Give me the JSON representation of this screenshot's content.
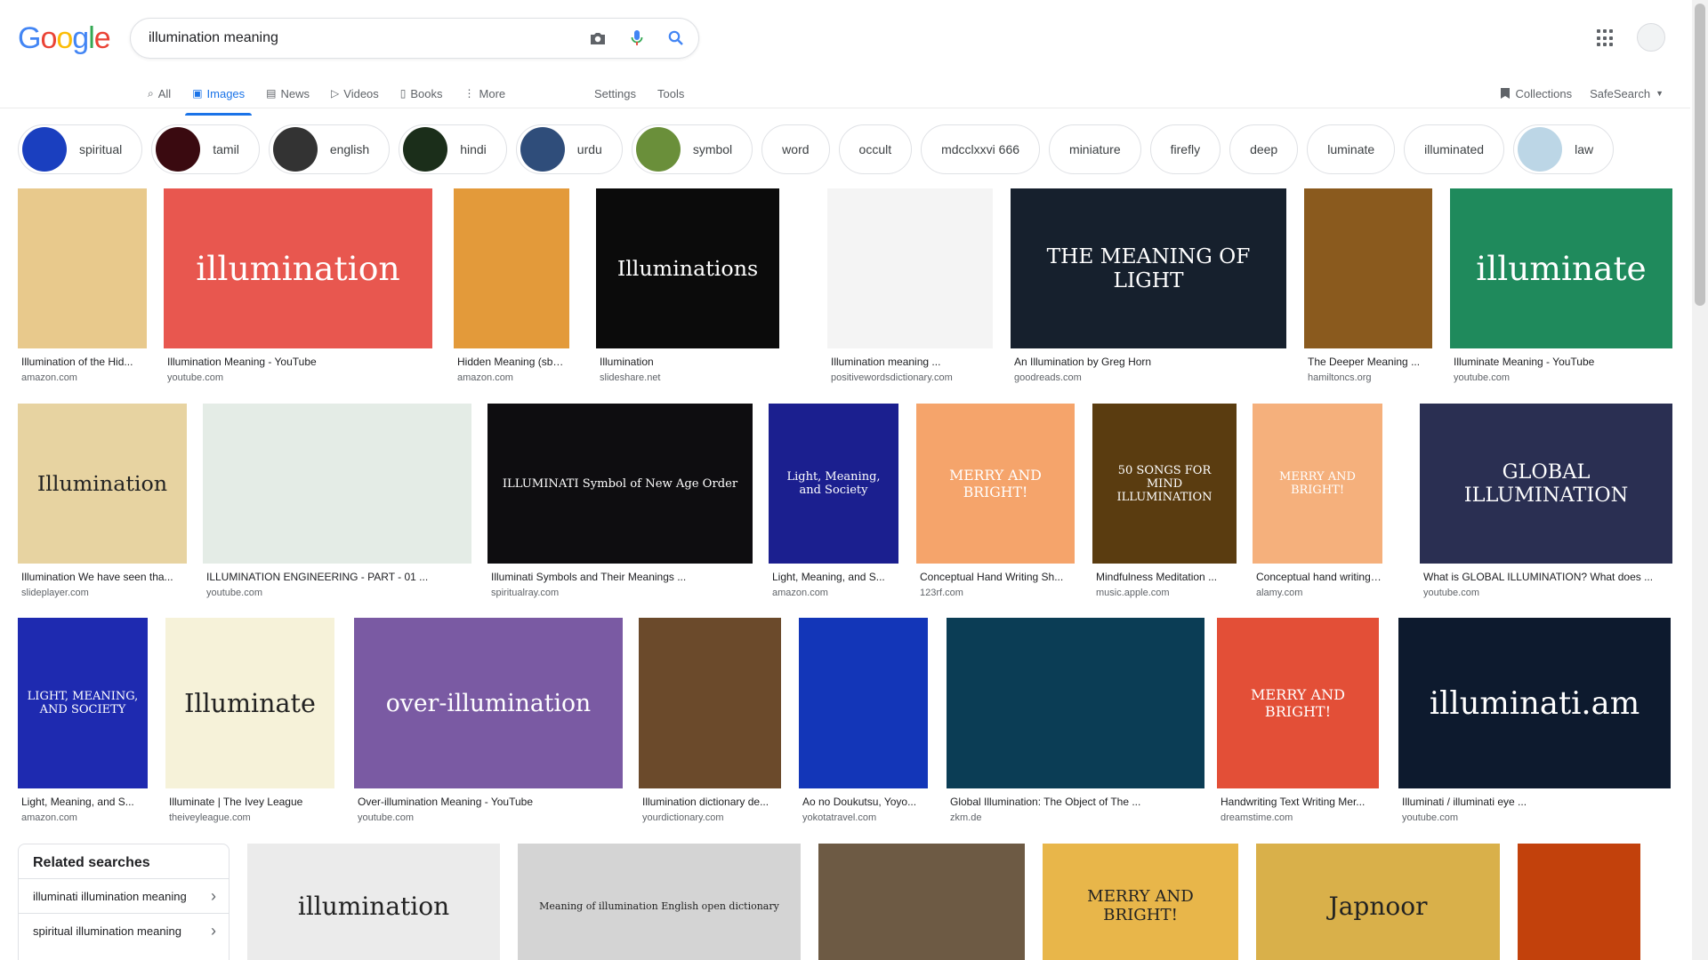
{
  "logo_letters": [
    {
      "ch": "G",
      "color": "#4285f4"
    },
    {
      "ch": "o",
      "color": "#ea4335"
    },
    {
      "ch": "o",
      "color": "#fbbc05"
    },
    {
      "ch": "g",
      "color": "#4285f4"
    },
    {
      "ch": "l",
      "color": "#34a853"
    },
    {
      "ch": "e",
      "color": "#ea4335"
    }
  ],
  "search": {
    "query": "illumination meaning"
  },
  "tabs": [
    {
      "label": "All",
      "icon": "search-icon"
    },
    {
      "label": "Images",
      "icon": "image-icon",
      "active": true
    },
    {
      "label": "News",
      "icon": "news-icon"
    },
    {
      "label": "Videos",
      "icon": "video-icon"
    },
    {
      "label": "Books",
      "icon": "book-icon"
    },
    {
      "label": "More",
      "icon": "more-vert-icon"
    }
  ],
  "tools": {
    "settings": "Settings",
    "tools": "Tools",
    "collections": "Collections",
    "safesearch": "SafeSearch"
  },
  "chips": [
    {
      "label": "spiritual",
      "img": true,
      "color": "#1a3fbf"
    },
    {
      "label": "tamil",
      "img": true,
      "color": "#3a0a10"
    },
    {
      "label": "english",
      "img": true,
      "color": "#333333"
    },
    {
      "label": "hindi",
      "img": true,
      "color": "#1b2e1a"
    },
    {
      "label": "urdu",
      "img": true,
      "color": "#2f4d7a"
    },
    {
      "label": "symbol",
      "img": true,
      "color": "#6a8f3a"
    },
    {
      "label": "word",
      "img": false
    },
    {
      "label": "occult",
      "img": false
    },
    {
      "label": "mdcclxxvi 666",
      "img": false
    },
    {
      "label": "miniature",
      "img": false
    },
    {
      "label": "firefly",
      "img": false
    },
    {
      "label": "deep",
      "img": false
    },
    {
      "label": "luminate",
      "img": false
    },
    {
      "label": "illuminated",
      "img": false
    },
    {
      "label": "law",
      "img": true,
      "color": "#bcd6e6"
    }
  ],
  "rows": [
    [
      {
        "title": "Illumination of the Hid...",
        "source": "amazon.com",
        "bg": "#e8c98c"
      },
      {
        "title": "Illumination Meaning - YouTube",
        "source": "youtube.com",
        "bg": "#e8574f",
        "text": "illumination"
      },
      {
        "title": "Hidden Meaning (sbas...",
        "source": "amazon.com",
        "bg": "#e39a3a"
      },
      {
        "title": "Illumination",
        "source": "slideshare.net",
        "bg": "#0b0b0b",
        "text": "Illuminations"
      },
      {
        "title": "Illumination meaning ...",
        "source": "positivewordsdictionary.com",
        "bg": "#f4f4f4"
      },
      {
        "title": "An Illumination by Greg Horn",
        "source": "goodreads.com",
        "bg": "#16202d",
        "text": "THE MEANING OF LIGHT"
      },
      {
        "title": "The Deeper Meaning ...",
        "source": "hamiltoncs.org",
        "bg": "#8a5a1e"
      },
      {
        "title": "Illuminate Meaning - YouTube",
        "source": "youtube.com",
        "bg": "#1f8a5c",
        "text": "illuminate"
      }
    ],
    [
      {
        "title": "Illumination We have seen tha...",
        "source": "slideplayer.com",
        "bg": "#e7d3a1",
        "text": "Illumination"
      },
      {
        "title": "ILLUMINATION ENGINEERING - PART - 01 ...",
        "source": "youtube.com",
        "bg": "#e4ece6"
      },
      {
        "title": "Illuminati Symbols and Their Meanings ...",
        "source": "spiritualray.com",
        "bg": "#0e0d10",
        "text": "ILLUMINATI Symbol of New Age Order"
      },
      {
        "title": "Light, Meaning, and S...",
        "source": "amazon.com",
        "bg": "#1b1f8f",
        "text": "Light, Meaning, and Society"
      },
      {
        "title": "Conceptual Hand Writing Sh...",
        "source": "123rf.com",
        "bg": "#f5a46b",
        "text": "MERRY AND BRIGHT!"
      },
      {
        "title": "Mindfulness Meditation ...",
        "source": "music.apple.com",
        "bg": "#5a3c10",
        "text": "50 SONGS FOR MIND ILLUMINATION"
      },
      {
        "title": "Conceptual hand writing s...",
        "source": "alamy.com",
        "bg": "#f5b07c",
        "text": "MERRY AND BRIGHT!"
      },
      {
        "title": "What is GLOBAL ILLUMINATION? What does ...",
        "source": "youtube.com",
        "bg": "#2a2f52",
        "text": "GLOBAL ILLUMINATION"
      }
    ],
    [
      {
        "title": "Light, Meaning, and S...",
        "source": "amazon.com",
        "bg": "#1e2ab0",
        "text": "LIGHT, MEANING, AND SOCIETY"
      },
      {
        "title": "Illuminate | The Ivey League",
        "source": "theiveyleague.com",
        "bg": "#f6f2d9",
        "text": "Illuminate"
      },
      {
        "title": "Over-illumination Meaning - YouTube",
        "source": "youtube.com",
        "bg": "#7a5aa3",
        "text": "over-illumination"
      },
      {
        "title": "Illumination dictionary de...",
        "source": "yourdictionary.com",
        "bg": "#6b4a2b"
      },
      {
        "title": "Ao no Doukutsu, Yoyo...",
        "source": "yokotatravel.com",
        "bg": "#1336b8"
      },
      {
        "title": "Global Illumination: The Object of The ...",
        "source": "zkm.de",
        "bg": "#0b3d55"
      },
      {
        "title": "Handwriting Text Writing Mer...",
        "source": "dreamstime.com",
        "bg": "#e34f37",
        "text": "MERRY AND BRIGHT!"
      },
      {
        "title": "Illuminati / illuminati eye ...",
        "source": "youtube.com",
        "bg": "#0d1a2e",
        "text": "illuminati.am"
      }
    ]
  ],
  "bottom_row": [
    {
      "bg": "#ebebeb",
      "text": "illumination"
    },
    {
      "bg": "#d4d4d4",
      "text": "Meaning of illumination English open dictionary"
    },
    {
      "bg": "#6d5a44"
    },
    {
      "bg": "#e8b64a",
      "text": "MERRY AND BRIGHT!"
    },
    {
      "bg": "#d9b04a",
      "text": "Japnoor"
    },
    {
      "bg": "#c2410c"
    }
  ],
  "related": {
    "title": "Related searches",
    "items": [
      "illuminati illumination meaning",
      "spiritual illumination meaning"
    ]
  }
}
